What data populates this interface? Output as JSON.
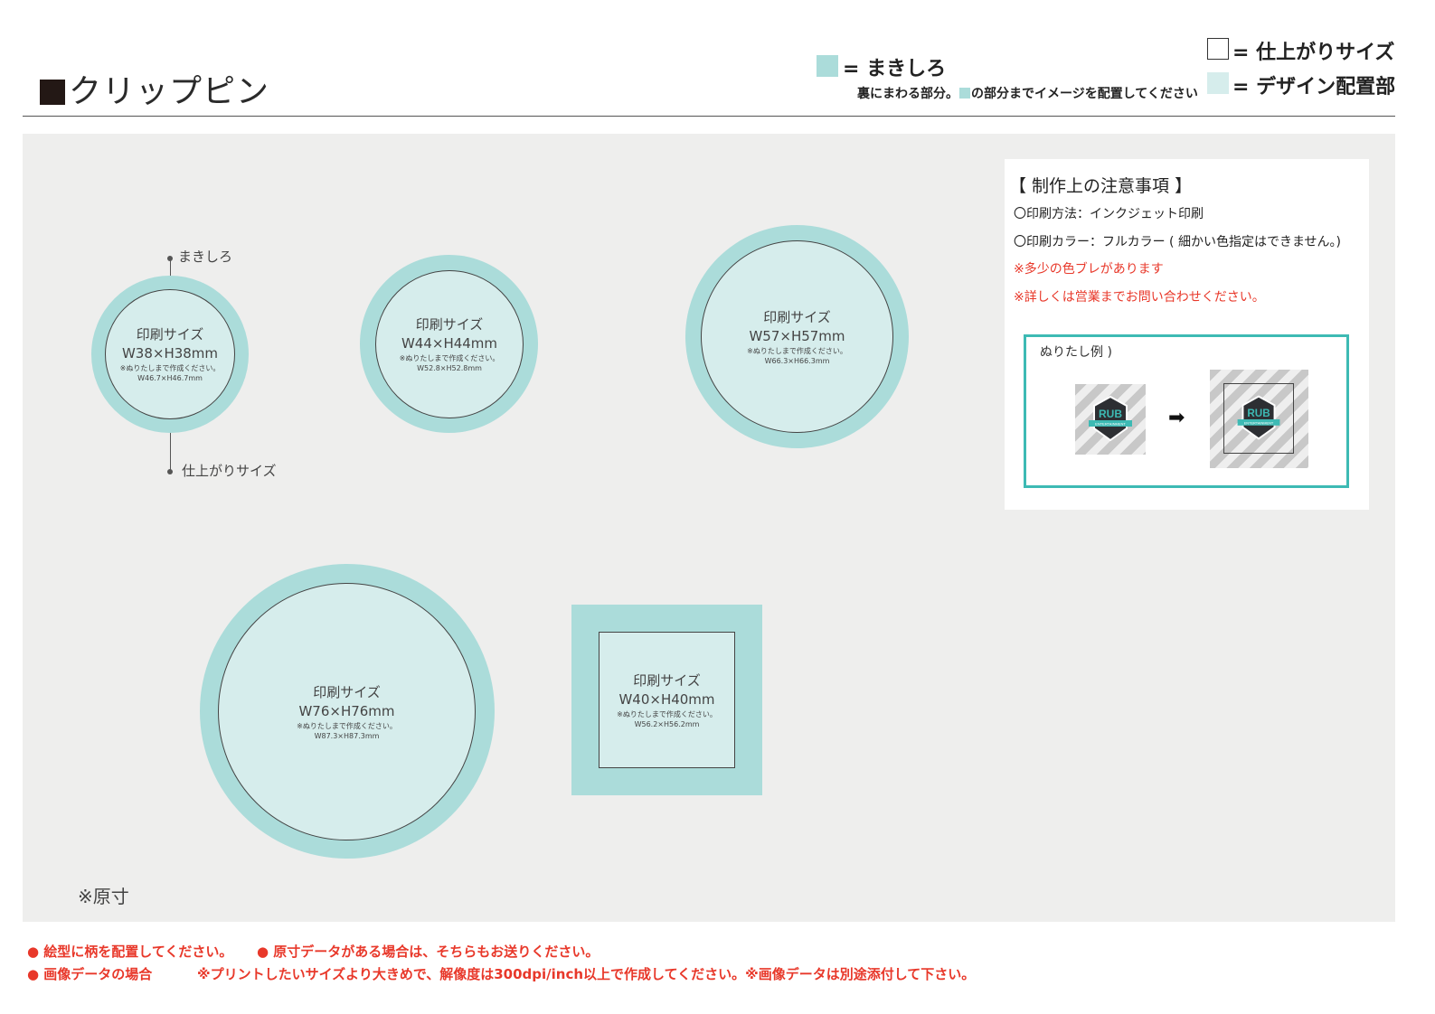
{
  "header": {
    "title": "クリップピン",
    "legend_bleed_label": "= まきしろ",
    "legend_bleed_note_pre": "裏にまわる部分。",
    "legend_bleed_note_post": "の部分までイメージを配置してください",
    "legend_finish_label": "= 仕上がりサイズ",
    "legend_design_label": "= デザイン配置部"
  },
  "callouts": {
    "bleed": "まきしろ",
    "finish": "仕上がりサイズ"
  },
  "items": [
    {
      "l1": "印刷サイズ",
      "l2": "W38×H38mm",
      "l3": "※ぬりたしまで作成ください。",
      "l4": "W46.7×H46.7mm"
    },
    {
      "l1": "印刷サイズ",
      "l2": "W44×H44mm",
      "l3": "※ぬりたしまで作成ください。",
      "l4": "W52.8×H52.8mm"
    },
    {
      "l1": "印刷サイズ",
      "l2": "W57×H57mm",
      "l3": "※ぬりたしまで作成ください。",
      "l4": "W66.3×H66.3mm"
    },
    {
      "l1": "印刷サイズ",
      "l2": "W76×H76mm",
      "l3": "※ぬりたしまで作成ください。",
      "l4": "W87.3×H87.3mm"
    },
    {
      "l1": "印刷サイズ",
      "l2": "W40×H40mm",
      "l3": "※ぬりたしまで作成ください。",
      "l4": "W56.2×H56.2mm"
    }
  ],
  "notes": {
    "heading": "【 制作上の注意事項 】",
    "method": "〇印刷方法：インクジェット印刷",
    "color": "〇印刷カラー：フルカラー ( 細かい色指定はできません。)",
    "warn1": "※多少の色ブレがあります",
    "warn2": "※詳しくは営業までお問い合わせください。",
    "example_label": "ぬりたし例 )",
    "logo_text": "RUB",
    "logo_sub": "ENTERTAINMENT"
  },
  "genshun": "※原寸",
  "footer": {
    "line1a": "● 絵型に柄を配置してください。",
    "line1b": "● 原寸データがある場合は、そちらもお送りください。",
    "line2a": "● 画像データの場合",
    "line2b": "※プリントしたいサイズより大きめで、解像度は300dpi/inch以上で作成してください。※画像データは別途添付して下さい。"
  },
  "colors": {
    "bleed": "#abdcda",
    "design": "#d6edec",
    "canvas": "#eeeeed",
    "accent": "#3dbab4",
    "warning": "#e8382a"
  }
}
